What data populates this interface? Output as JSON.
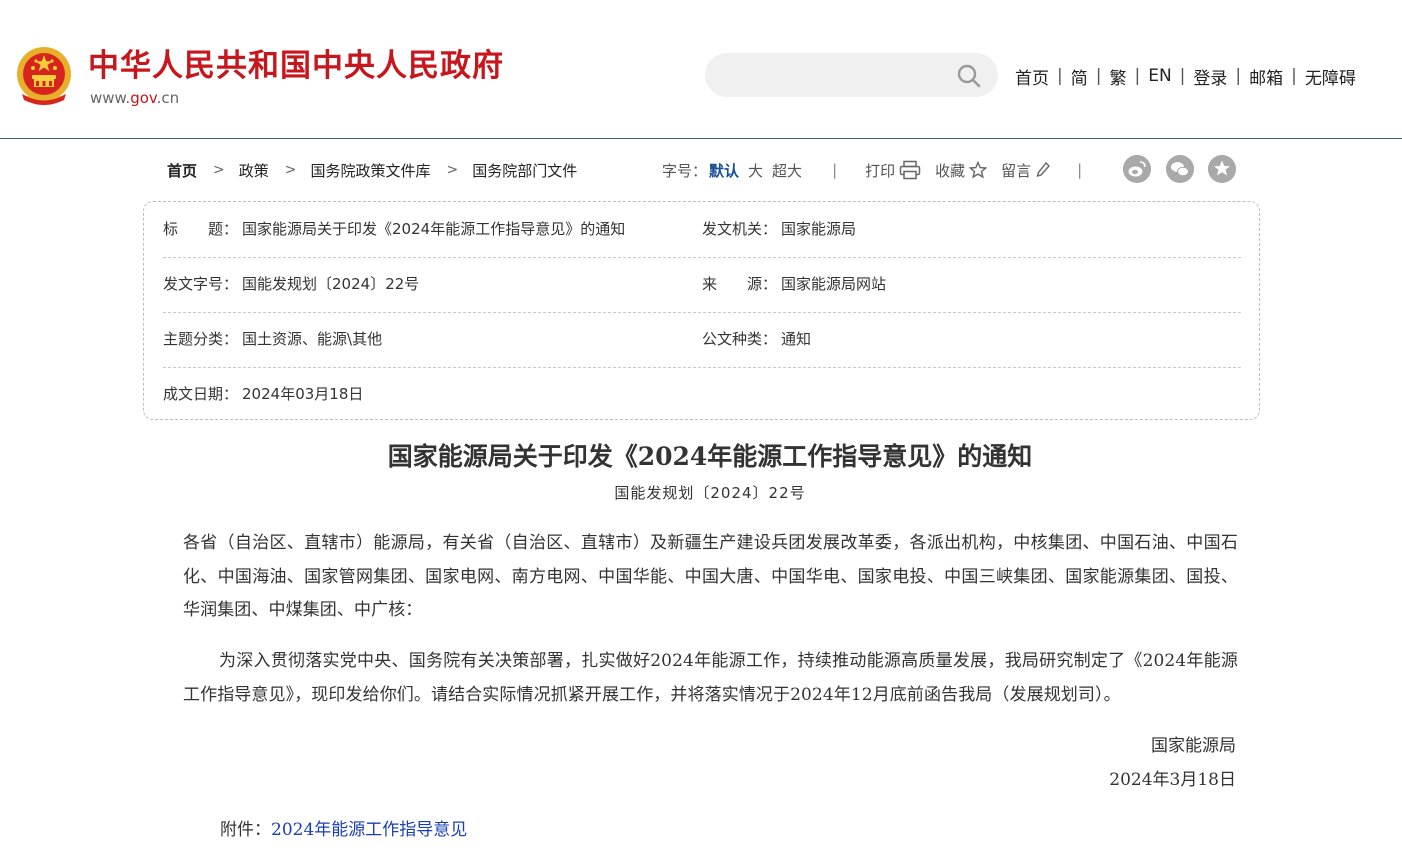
{
  "header": {
    "site_title": "中华人民共和国中央人民政府",
    "domain_prefix": "www.",
    "domain_brand": "gov",
    "domain_suffix": ".cn",
    "search_placeholder": "",
    "nav": [
      "首页",
      "简",
      "繁",
      "EN",
      "登录",
      "邮箱",
      "无障碍"
    ],
    "brand_color": "#c8161d"
  },
  "breadcrumb": [
    "首页",
    "政策",
    "国务院政策文件库",
    "国务院部门文件"
  ],
  "tools": {
    "font_size_label": "字号：",
    "font_sizes": [
      "默认",
      "大",
      "超大"
    ],
    "print": "打印",
    "favorite": "收藏",
    "comment": "留言",
    "divider": "|"
  },
  "info": {
    "title_label": "标　　题：",
    "title_value": "国家能源局关于印发《2024年能源工作指导意见》的通知",
    "issuer_label": "发文机关：",
    "issuer_value": "国家能源局",
    "doc_no_label": "发文字号：",
    "doc_no_value": "国能发规划〔2024〕22号",
    "source_label": "来　　源：",
    "source_value": "国家能源局网站",
    "topic_label": "主题分类：",
    "topic_value": "国土资源、能源\\其他",
    "type_label": "公文种类：",
    "type_value": "通知",
    "date_label": "成文日期：",
    "date_value": "2024年03月18日"
  },
  "article": {
    "title": "国家能源局关于印发《2024年能源工作指导意见》的通知",
    "doc_no": "国能发规划〔2024〕22号",
    "p1": "各省（自治区、直辖市）能源局，有关省（自治区、直辖市）及新疆生产建设兵团发展改革委，各派出机构，中核集团、中国石油、中国石化、中国海油、国家管网集团、国家电网、南方电网、中国华能、中国大唐、中国华电、国家电投、中国三峡集团、国家能源集团、国投、华润集团、中煤集团、中广核：",
    "p2": "为深入贯彻落实党中央、国务院有关决策部署，扎实做好2024年能源工作，持续推动能源高质量发展，我局研究制定了《2024年能源工作指导意见》，现印发给你们。请结合实际情况抓紧开展工作，并将落实情况于2024年12月底前函告我局（发展规划司）。",
    "signer": "国家能源局",
    "sign_date": "2024年3月18日",
    "attachment_label": "附件：",
    "attachment_link": "2024年能源工作指导意见"
  }
}
